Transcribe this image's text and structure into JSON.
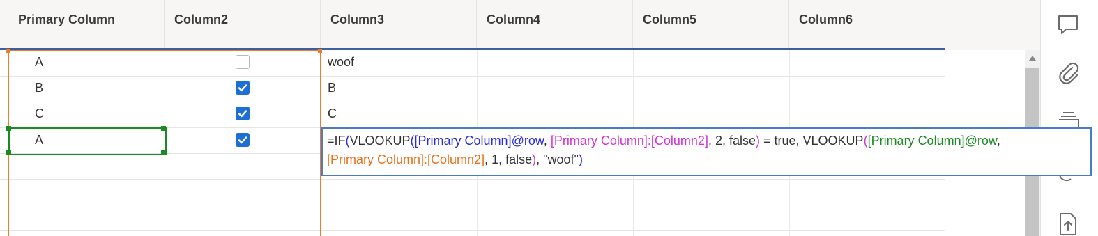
{
  "columns": [
    "Primary Column",
    "Column2",
    "Column3",
    "Column4",
    "Column5",
    "Column6"
  ],
  "rows": [
    {
      "primary": "A",
      "checked": false,
      "col3": "woof"
    },
    {
      "primary": "B",
      "checked": true,
      "col3": "B"
    },
    {
      "primary": "C",
      "checked": true,
      "col3": "C"
    },
    {
      "primary": "A",
      "checked": true,
      "col3": ""
    }
  ],
  "formula": {
    "t01": "=IF",
    "t02": "(",
    "t03": "VLOOKUP",
    "t04": "(",
    "t05": "[Primary Column]@row",
    "t06": ", ",
    "t07": "[Primary Column]:[Column2]",
    "t08": ", 2, false",
    "t09": ")",
    "t10": " = true, VLOOKUP",
    "t11": "(",
    "t12": "[Primary Column]@row",
    "t13": ",",
    "t14": "[Primary Column]:[Column2]",
    "t15": ", 1, false",
    "t16": ")",
    "t17": ", \"woof\"",
    "t18": ")"
  },
  "right_toolbar": [
    "comment-icon",
    "attachment-icon",
    "proofing-icon",
    "update-requests-icon",
    "publish-icon"
  ],
  "colors": {
    "accent_blue": "#1e6fd4",
    "header_underline": "#3f5f9a",
    "orange_ref": "#ef6c12",
    "green_ref": "#1a8a24",
    "magenta_ref": "#d52fd5",
    "blue_ref": "#2a2ad8"
  }
}
